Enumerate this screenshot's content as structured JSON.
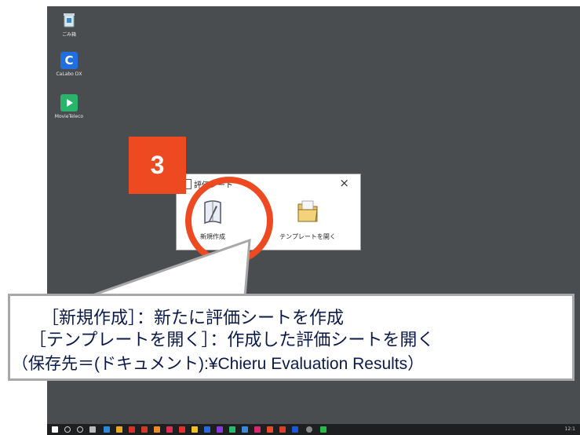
{
  "desktop": {
    "icons": [
      {
        "name": "recycle-bin-icon",
        "label": "ごみ箱",
        "color": "#6aa8d8"
      },
      {
        "name": "calabo-dx-icon",
        "label": "CaLabo DX",
        "color": "#1f6fe0"
      },
      {
        "name": "movie-telecoco-icon",
        "label": "MovieTeleco",
        "color": "#29b36b"
      }
    ]
  },
  "step_badge": "3",
  "dialog": {
    "title": "評価シート",
    "close": "×",
    "new_label": "新規作成",
    "open_label": "テンプレートを開く"
  },
  "callout": {
    "line1": "［新規作成］：新たに評価シートを作成",
    "line2": "［テンプレートを開く］：作成した評価シートを開く",
    "line3": "（保存先＝(ドキュメント):¥Chieru Evaluation Results）"
  },
  "taskbar": {
    "clock": "12:1"
  },
  "colors": {
    "accent": "#ee4a22",
    "desktop": "#4a4d50",
    "callout_text": "#0a1a4a"
  }
}
